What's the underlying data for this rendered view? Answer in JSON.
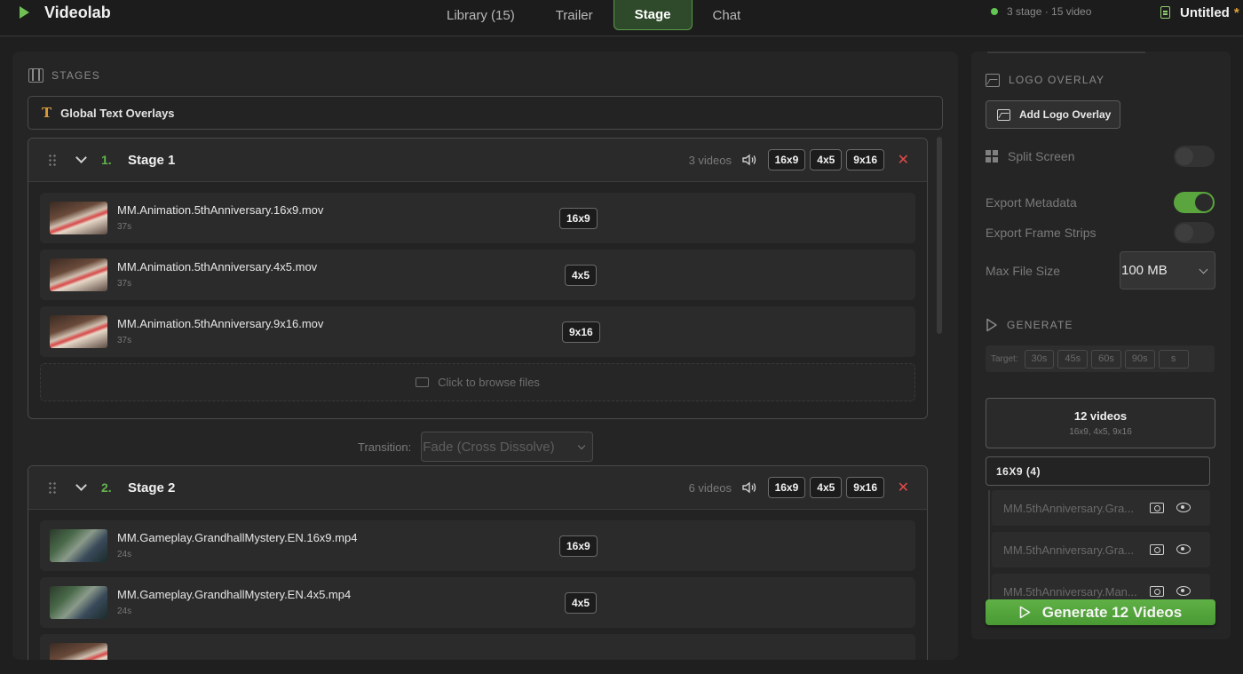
{
  "app": {
    "name": "Videolab",
    "status": "3 stage · 15 video",
    "document": "Untitled",
    "unsaved_marker": "*",
    "accent": "#5aa53e"
  },
  "tabs": [
    {
      "label": "Library (15)",
      "active": false
    },
    {
      "label": "Trailer",
      "active": false
    },
    {
      "label": "Stage",
      "active": true
    },
    {
      "label": "Chat",
      "active": false
    }
  ],
  "stages_panel": {
    "heading": "STAGES",
    "global_overlays": "Global Text Overlays",
    "transition_label": "Transition:",
    "transition_value": "Fade (Cross Dissolve)",
    "stages": [
      {
        "number": "1.",
        "title": "Stage 1",
        "count": "3 videos",
        "ratios": [
          "16x9",
          "4x5",
          "9x16"
        ],
        "videos": [
          {
            "name": "MM.Animation.5thAnniversary.16x9.mov",
            "duration": "37s",
            "ratio": "16x9"
          },
          {
            "name": "MM.Animation.5thAnniversary.4x5.mov",
            "duration": "37s",
            "ratio": "4x5"
          },
          {
            "name": "MM.Animation.5thAnniversary.9x16.mov",
            "duration": "37s",
            "ratio": "9x16"
          }
        ],
        "browse": "Click to browse files"
      },
      {
        "number": "2.",
        "title": "Stage 2",
        "count": "6 videos",
        "ratios": [
          "16x9",
          "4x5",
          "9x16"
        ],
        "videos": [
          {
            "name": "MM.Gameplay.GrandhallMystery.EN.16x9.mp4",
            "duration": "24s",
            "ratio": "16x9"
          },
          {
            "name": "MM.Gameplay.GrandhallMystery.EN.4x5.mp4",
            "duration": "24s",
            "ratio": "4x5"
          }
        ]
      }
    ]
  },
  "settings": {
    "logo_heading": "LOGO OVERLAY",
    "add_logo": "Add Logo Overlay",
    "split_screen": {
      "label": "Split Screen",
      "on": false
    },
    "export_metadata": {
      "label": "Export Metadata",
      "on": true
    },
    "export_strips": {
      "label": "Export Frame Strips",
      "on": false
    },
    "max_file_size": {
      "label": "Max File Size",
      "value": "100 MB"
    },
    "generate_heading": "GENERATE",
    "target_label": "Target:",
    "targets": [
      "30s",
      "45s",
      "60s",
      "90s",
      "s"
    ],
    "summary_count": "12 videos",
    "summary_formats": "16x9, 4x5, 9x16",
    "group": "16X9 (4)",
    "outputs": [
      "MM.5thAnniversary.Gra...",
      "MM.5thAnniversary.Gra...",
      "MM.5thAnniversary.Man..."
    ],
    "generate_button": "Generate 12 Videos"
  }
}
